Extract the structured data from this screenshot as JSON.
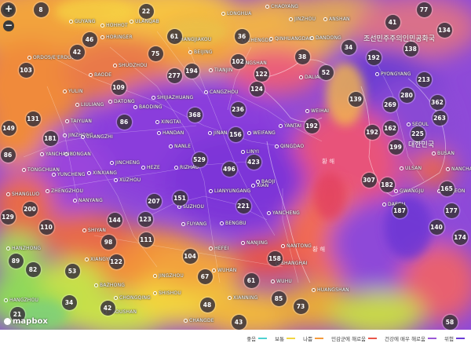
{
  "map": {
    "zoom_in_label": "+",
    "zoom_out_label": "−",
    "logo_text": "mapbox",
    "country_label_korea": "조선민주주의인민공화국",
    "korea_south_label": "대한민국",
    "sea_label_1": "황 해",
    "sea_label_2": "황 해"
  },
  "cities": [
    {
      "name": "GUYANG",
      "cls": ""
    },
    {
      "name": "HOHHOT",
      "cls": ""
    },
    {
      "name": "ULANQAB",
      "cls": ""
    },
    {
      "name": "LONGHUA",
      "cls": ""
    },
    {
      "name": "CHAOYANG",
      "cls": ""
    },
    {
      "name": "JINZHOU",
      "cls": ""
    },
    {
      "name": "ANSHAN",
      "cls": ""
    },
    {
      "name": "HORINGER",
      "cls": ""
    },
    {
      "name": "ZHANGJIAKOU",
      "cls": ""
    },
    {
      "name": "CHENGDE",
      "cls": ""
    },
    {
      "name": "QINHUANGDAO",
      "cls": ""
    },
    {
      "name": "DANDONG",
      "cls": ""
    },
    {
      "name": "ORDOS/E'ERDUOSI",
      "cls": ""
    },
    {
      "name": "SHUOZHOU",
      "cls": ""
    },
    {
      "name": "BAODE",
      "cls": ""
    },
    {
      "name": "BEIJING",
      "cls": ""
    },
    {
      "name": "TANGSHAN",
      "cls": ""
    },
    {
      "name": "TIANJIN",
      "cls": ""
    },
    {
      "name": "DALIAN",
      "cls": ""
    },
    {
      "name": "PYONGYANG",
      "cls": ""
    },
    {
      "name": "YULIN",
      "cls": ""
    },
    {
      "name": "DATONG",
      "cls": ""
    },
    {
      "name": "BAODING",
      "cls": ""
    },
    {
      "name": "CANGZHOU",
      "cls": ""
    },
    {
      "name": "SEOUL",
      "cls": ""
    },
    {
      "name": "LIULIANG",
      "cls": ""
    },
    {
      "name": "TAIYUAN",
      "cls": ""
    },
    {
      "name": "SHIJIAZHUANG",
      "cls": ""
    },
    {
      "name": "WEIHAI",
      "cls": ""
    },
    {
      "name": "JINZHONG",
      "cls": ""
    },
    {
      "name": "YANTAI",
      "cls": ""
    },
    {
      "name": "CHANGZHI",
      "cls": ""
    },
    {
      "name": "HANDAN",
      "cls": ""
    },
    {
      "name": "JINAN",
      "cls": ""
    },
    {
      "name": "XINGTAI",
      "cls": ""
    },
    {
      "name": "WEIFANG",
      "cls": ""
    },
    {
      "name": "YANCHANG",
      "cls": ""
    },
    {
      "name": "YONGAN",
      "cls": ""
    },
    {
      "name": "JINCHENG",
      "cls": ""
    },
    {
      "name": "NANLE",
      "cls": ""
    },
    {
      "name": "LINYI",
      "cls": ""
    },
    {
      "name": "QINGDAO",
      "cls": ""
    },
    {
      "name": "TONGCHUAN",
      "cls": ""
    },
    {
      "name": "YUNCHENG",
      "cls": ""
    },
    {
      "name": "XINXIANG",
      "cls": ""
    },
    {
      "name": "HEZE",
      "cls": ""
    },
    {
      "name": "RIZHAO",
      "cls": ""
    },
    {
      "name": "XIAN",
      "cls": ""
    },
    {
      "name": "ZHENGZHOU",
      "cls": ""
    },
    {
      "name": "XUZHOU",
      "cls": ""
    },
    {
      "name": "LIANYUNGANG",
      "cls": ""
    },
    {
      "name": "BAOJI",
      "cls": ""
    },
    {
      "name": "SHANGLUO",
      "cls": ""
    },
    {
      "name": "NANYANG",
      "cls": ""
    },
    {
      "name": "SUZHOU",
      "cls": ""
    },
    {
      "name": "YANCHENG",
      "cls": ""
    },
    {
      "name": "SHIYAN",
      "cls": ""
    },
    {
      "name": "FUYANG",
      "cls": ""
    },
    {
      "name": "BENGBU",
      "cls": ""
    },
    {
      "name": "NANTONG",
      "cls": ""
    },
    {
      "name": "HANZHONG",
      "cls": ""
    },
    {
      "name": "XIANGYANG",
      "cls": ""
    },
    {
      "name": "HEFEI",
      "cls": ""
    },
    {
      "name": "NANJING",
      "cls": ""
    },
    {
      "name": "SHANGHAI",
      "cls": ""
    },
    {
      "name": "BAZHONG",
      "cls": ""
    },
    {
      "name": "JINGZHOU",
      "cls": ""
    },
    {
      "name": "WUHAN",
      "cls": ""
    },
    {
      "name": "WUHU",
      "cls": ""
    },
    {
      "name": "HANGZHOU",
      "cls": ""
    },
    {
      "name": "CHONGQING",
      "cls": ""
    },
    {
      "name": "SHISHOU",
      "cls": ""
    },
    {
      "name": "XIANNING",
      "cls": ""
    },
    {
      "name": "HUANGSHAN",
      "cls": ""
    },
    {
      "name": "ZHOUSHAN",
      "cls": ""
    },
    {
      "name": "CHANGDE",
      "cls": ""
    },
    {
      "name": "NANCHANG",
      "cls": ""
    },
    {
      "name": "BUSAN",
      "cls": ""
    },
    {
      "name": "DAEGU",
      "cls": ""
    },
    {
      "name": "GWANGJU",
      "cls": ""
    },
    {
      "name": "DAEJEON",
      "cls": ""
    },
    {
      "name": "ULSAN",
      "cls": ""
    },
    {
      "name": "JEONJU",
      "cls": ""
    }
  ],
  "markers": [
    "27",
    "8",
    "77",
    "22",
    "61",
    "36",
    "41",
    "46",
    "134",
    "42",
    "75",
    "38",
    "34",
    "52",
    "103",
    "192",
    "138",
    "102",
    "122",
    "277",
    "194",
    "124",
    "213",
    "280",
    "109",
    "236",
    "139",
    "269",
    "362",
    "131",
    "86",
    "368",
    "192",
    "263",
    "192",
    "162",
    "225",
    "149",
    "181",
    "199",
    "156",
    "529",
    "496",
    "423",
    "86",
    "307",
    "182",
    "165",
    "207",
    "151",
    "221",
    "187",
    "177",
    "200",
    "110",
    "144",
    "123",
    "140",
    "174",
    "129",
    "98",
    "111",
    "104",
    "158",
    "89",
    "122",
    "82",
    "53",
    "67",
    "61",
    "85",
    "73",
    "34",
    "42",
    "48",
    "43",
    "21",
    "58"
  ],
  "legend": [
    {
      "label": "좋음",
      "color": "#4fd1d1"
    },
    {
      "label": "보통",
      "color": "#f2d541"
    },
    {
      "label": "나쁨",
      "color": "#f59a3b"
    },
    {
      "label": "민감군에 해로움",
      "color": "#e9564a"
    },
    {
      "label": "건강에 매우 해로움",
      "color": "#9b58d6"
    },
    {
      "label": "위험",
      "color": "#6a3cd6"
    }
  ],
  "colors": {
    "good": "#4fd1d1",
    "moderate": "#f2d541",
    "unhealthy_sensitive": "#f59a3b",
    "unhealthy": "#e9564a",
    "very_unhealthy": "#9b58d6",
    "hazardous": "#6a3cd6"
  }
}
